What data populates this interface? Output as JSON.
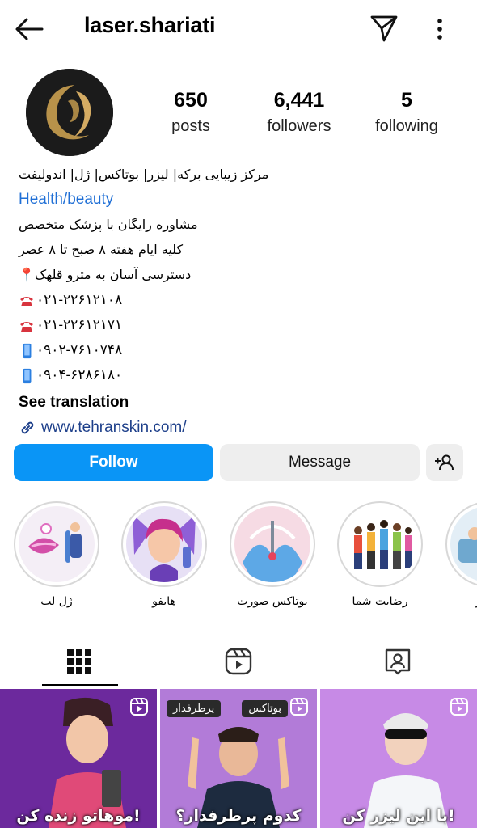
{
  "header": {
    "username": "laser.shariati",
    "back_icon": "arrow-left-icon",
    "send_icon": "paper-plane-icon",
    "more_icon": "more-vertical-icon"
  },
  "stats": {
    "posts": {
      "value": "650",
      "label": "posts"
    },
    "followers": {
      "value": "6,441",
      "label": "followers"
    },
    "following": {
      "value": "5",
      "label": "following"
    }
  },
  "bio": {
    "name": "مرکز زیبایی برکه| لیزر| بوتاکس| ژل| اندولیفت",
    "category": "Health/beauty",
    "lines": [
      "مشاوره رایگان با پزشک متخصص",
      "کلیه ایام هفته ۸ صبح تا ۸ عصر",
      "دسترسی آسان به مترو قلهک📍"
    ],
    "phones": [
      {
        "icon": "telephone-icon",
        "text": "۰۲۱-۲۲۶۱۲۱۰۸"
      },
      {
        "icon": "telephone-icon",
        "text": "۰۲۱-۲۲۶۱۲۱۷۱"
      },
      {
        "icon": "mobile-phone-icon",
        "text": "۰۹۰۲-۷۶۱۰۷۴۸"
      },
      {
        "icon": "mobile-phone-icon",
        "text": "۰۹۰۴-۶۲۸۶۱۸۰"
      }
    ],
    "see_translation": "See translation",
    "website": "www.tehranskin.com/"
  },
  "actions": {
    "follow": "Follow",
    "message": "Message",
    "add_user_icon": "add-user-icon"
  },
  "highlights": [
    {
      "label": "ژل لب"
    },
    {
      "label": "هایفو"
    },
    {
      "label": "بوتاکس صورت"
    },
    {
      "label": "رضایت شما"
    },
    {
      "label": "استار"
    }
  ],
  "tabs": [
    "grid-icon",
    "reels-icon",
    "tagged-icon"
  ],
  "posts": [
    {
      "caption": "!موهاتو زنده کن"
    },
    {
      "caption": "کدوم پرطرفدار؟",
      "tag_top_left": "پرطرفدار",
      "tag_top_right": "بوتاکس"
    },
    {
      "caption": "!با این لیزر کن"
    }
  ],
  "colors": {
    "accent": "#0a95f6",
    "link": "#1f6fd6",
    "button_bg": "#eeeeee"
  }
}
